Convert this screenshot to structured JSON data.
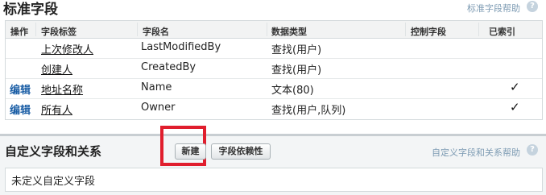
{
  "standard_fields": {
    "title": "标准字段",
    "help_link": "标准字段帮助",
    "help_icon": "help-icon",
    "columns": [
      "操作",
      "字段标签",
      "字段名",
      "数据类型",
      "控制字段",
      "已索引"
    ],
    "rows": [
      {
        "action": "",
        "label": "上次修改人",
        "name": "LastModifiedBy",
        "type": "查找(用户)",
        "controlling": "",
        "indexed": ""
      },
      {
        "action": "",
        "label": "创建人",
        "name": "CreatedBy",
        "type": "查找(用户)",
        "controlling": "",
        "indexed": ""
      },
      {
        "action": "编辑",
        "label": "地址名称",
        "name": "Name",
        "type": "文本(80)",
        "controlling": "",
        "indexed": "✓"
      },
      {
        "action": "编辑",
        "label": "所有人",
        "name": "Owner",
        "type": "查找(用户,队列)",
        "controlling": "",
        "indexed": "✓"
      }
    ]
  },
  "custom_fields": {
    "title": "自定义字段和关系",
    "new_button": "新建",
    "dependency_button": "字段依赖性",
    "help_link": "自定义字段和关系帮助",
    "empty_message": "未定义自定义字段"
  },
  "colors": {
    "highlight": "#e01e2d",
    "link": "#1c5fa6",
    "help": "#7d9bb3"
  }
}
